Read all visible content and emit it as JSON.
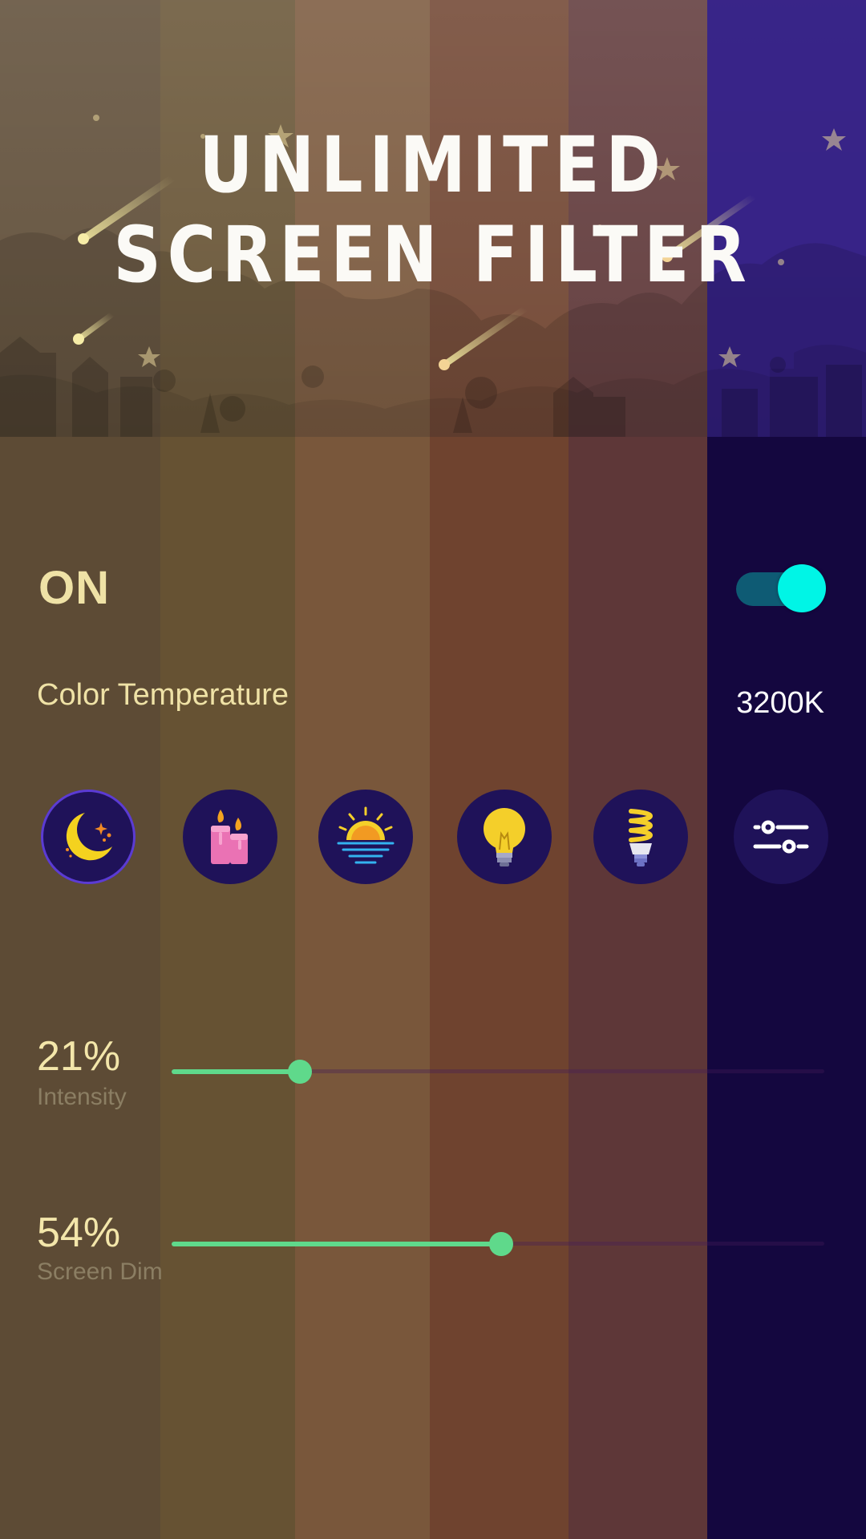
{
  "colors": {
    "stripes": [
      "#5d4b35",
      "#665233",
      "#79573b",
      "#6f432f",
      "#5e3738",
      "#14073f"
    ],
    "accent_green": "#5fd98b",
    "toggle_knob": "#00f5e6",
    "toggle_track": "#0e5b74",
    "label_cream": "#efe2a6"
  },
  "header": {
    "title_line1": "UNLIMITED",
    "title_line2": "SCREEN FILTER"
  },
  "power": {
    "label": "ON",
    "enabled": true
  },
  "color_temperature": {
    "label": "Color Temperature",
    "value": "3200K"
  },
  "presets": [
    {
      "icon": "moon-icon",
      "selected": true
    },
    {
      "icon": "candles-icon",
      "selected": false
    },
    {
      "icon": "sunset-icon",
      "selected": false
    },
    {
      "icon": "lightbulb-icon",
      "selected": false
    },
    {
      "icon": "fluorescent-bulb-icon",
      "selected": false
    },
    {
      "icon": "sliders-icon",
      "selected": false
    }
  ],
  "intensity": {
    "percent_label": "21%",
    "label": "Intensity",
    "value": 0.21
  },
  "screen_dim": {
    "percent_label": "54%",
    "label": "Screen Dim",
    "value": 0.54
  }
}
